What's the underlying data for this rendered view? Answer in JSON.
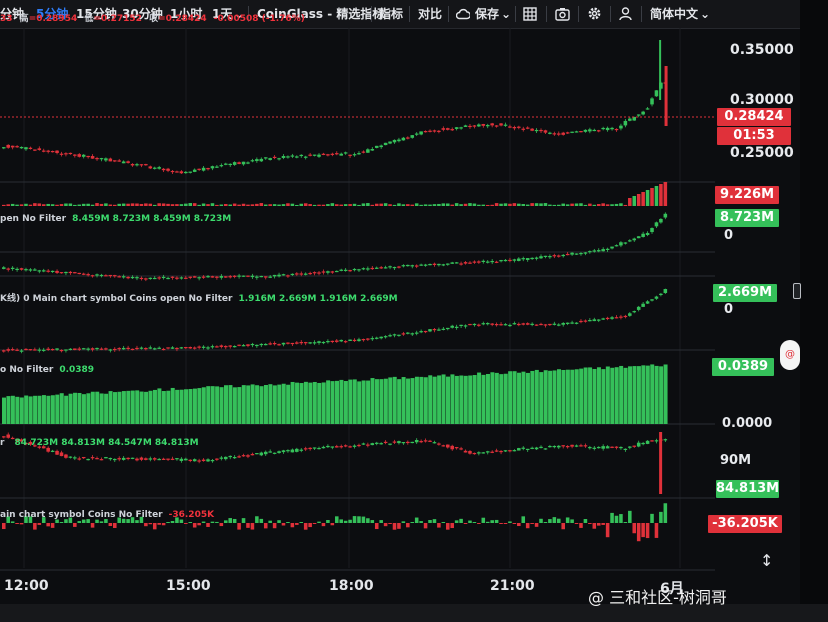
{
  "toolbar": {
    "interval_1": "分钟",
    "interval_5": "5分钟",
    "interval_15": "15分钟",
    "interval_30": "30分钟",
    "interval_1h": "1小时",
    "interval_1d": "1天",
    "dropdown_caret": "⌄",
    "indicator_set": "CoinGlass - 精选指标",
    "indicators": "指标",
    "compare": "对比",
    "save": "保存",
    "language": "简体中文"
  },
  "ohlc": {
    "open_prefix": "33",
    "high_label": "高",
    "high": "=0.28954",
    "low_label": "低",
    "low": "=0.27152",
    "close_label": "收",
    "close": "=0.28424",
    "change": "-0.00508 (-1.76%)"
  },
  "price_axis": {
    "ticks": [
      "0.35000",
      "0.30000",
      "0.25000"
    ],
    "last_price": "0.28424",
    "countdown": "01:53"
  },
  "panes": {
    "volume": {
      "tag": "9.226M"
    },
    "open_interest": {
      "label": "pen No Filter",
      "values": "8.459M 8.723M 8.459M 8.723M",
      "tag": "8.723M",
      "zero": "0"
    },
    "oi_coin": {
      "label": "K线) 0 Main chart symbol Coins open No Filter",
      "values": "1.916M 2.669M 1.916M 2.669M",
      "tag": "2.669M",
      "zero": "0"
    },
    "ratio": {
      "label": "o No Filter",
      "values": "0.0389",
      "tag": "0.0389",
      "zero": "0.0000"
    },
    "cum": {
      "label": "r",
      "values": "84.723M 84.813M 84.547M 84.813M",
      "tick": "90M",
      "tag": "84.813M"
    },
    "delta": {
      "label": "ain chart symbol Coins No Filter",
      "values": "-36.205K",
      "tag": "-36.205K"
    }
  },
  "time_axis": [
    "12:00",
    "15:00",
    "18:00",
    "21:00",
    "6月"
  ],
  "watermark": "@ 三和社区-树洞哥",
  "colors": {
    "up": "#35c05a",
    "down": "#e0313a",
    "accent": "#2f7cf6",
    "background": "#0c0d10"
  }
}
